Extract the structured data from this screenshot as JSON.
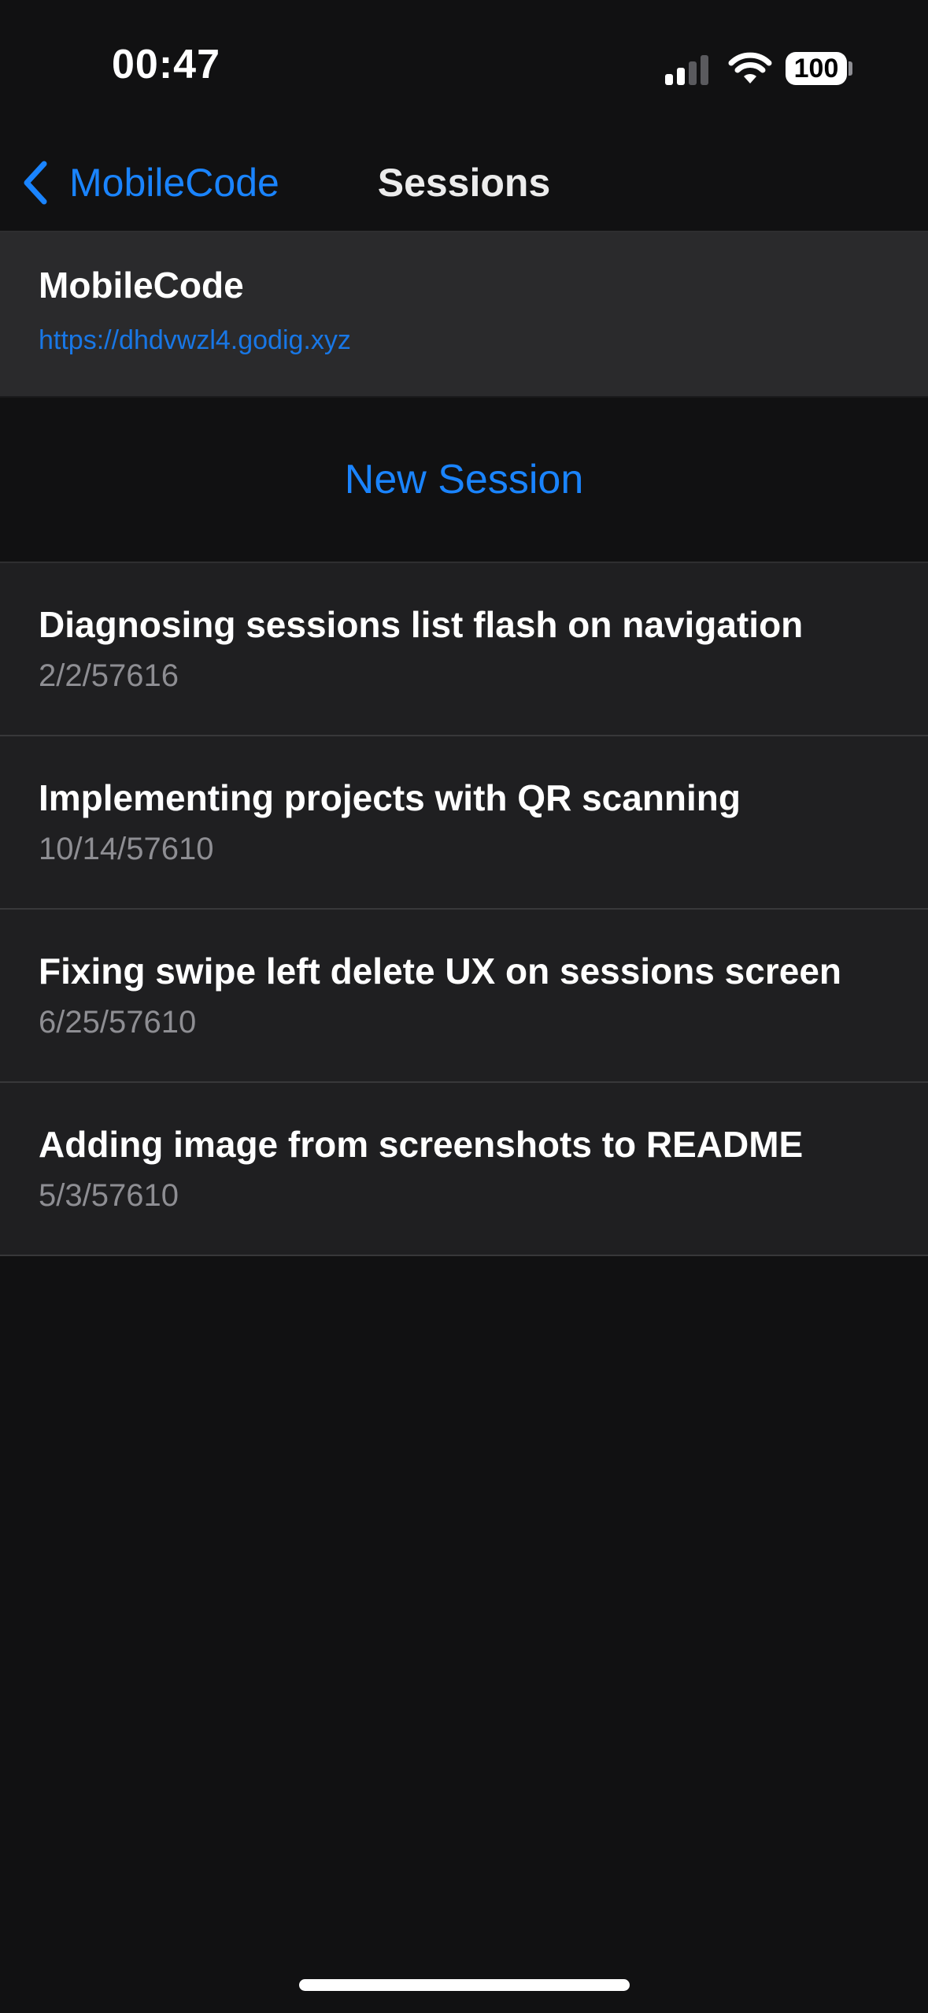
{
  "status_bar": {
    "time": "00:47",
    "battery": "100",
    "icons": [
      "cellular-signal-icon",
      "wifi-icon",
      "battery-icon"
    ]
  },
  "nav": {
    "back_label": "MobileCode",
    "title": "Sessions",
    "back_icon": "chevron-left-icon"
  },
  "project": {
    "name": "MobileCode",
    "url": "https://dhdvwzl4.godig.xyz"
  },
  "new_session": {
    "label": "New Session"
  },
  "sessions": [
    {
      "title": "Diagnosing sessions list flash on navigation",
      "date": "2/2/57616"
    },
    {
      "title": "Implementing projects with QR scanning",
      "date": "10/14/57610"
    },
    {
      "title": "Fixing swipe left delete UX on sessions screen",
      "date": "6/25/57610"
    },
    {
      "title": "Adding image from screenshots to README",
      "date": "5/3/57610"
    }
  ],
  "colors": {
    "accent": "#1a84ff",
    "background": "#111112",
    "row_background": "#1f1f21",
    "header_background": "#2a2a2c",
    "secondary_text": "#8e8e93"
  }
}
